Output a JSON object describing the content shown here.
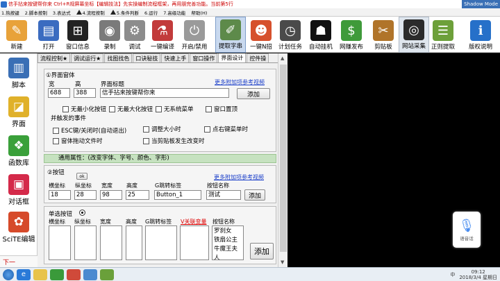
{
  "titlebar": {
    "text": "信手拈来按键帮你来 Ctrl+R规屏幕坐标【编辑技法】先实操编制流程框架，再用朋完善功能。当前第5行",
    "badge": "Shadow Mode"
  },
  "steps": [
    {
      "label": "1.热按键"
    },
    {
      "label": "2.脚本按制"
    },
    {
      "label": "3.表达式"
    },
    {
      "label": "4.流程按制"
    },
    {
      "label": "5.条件判断"
    },
    {
      "label": "6.运行"
    },
    {
      "label": "7.高级功能"
    },
    {
      "label": "帮助(H)"
    }
  ],
  "toolbar": [
    {
      "label": "新建",
      "icon": "new-doc-icon",
      "color": "#e8a23a",
      "glyph": "✎"
    },
    {
      "label": "打开",
      "icon": "open-book-icon",
      "color": "#3b6cc0",
      "glyph": "▤"
    },
    {
      "label": "窗口信息",
      "icon": "window-info-icon",
      "color": "#222222",
      "glyph": "⊞"
    },
    {
      "label": "录制",
      "icon": "webcam-icon",
      "color": "#7a7a7a",
      "glyph": "◉"
    },
    {
      "label": "调试",
      "icon": "gears-icon",
      "color": "#8c8c8c",
      "glyph": "⚙"
    },
    {
      "label": "一键编译",
      "icon": "compile-icon",
      "color": "#c23b3b",
      "glyph": "⚗"
    },
    {
      "label": "开启/禁用",
      "icon": "toggle-icon",
      "color": "#9a9a9a",
      "glyph": "⏻"
    },
    {
      "label": "提取字串",
      "icon": "pen-icon",
      "color": "#5d8a4a",
      "glyph": "✐"
    },
    {
      "label": "一键N招",
      "icon": "avatar-icon",
      "color": "#d6502c",
      "glyph": "☻"
    },
    {
      "label": "计划任务",
      "icon": "clock-icon",
      "color": "#4a4a4a",
      "glyph": "◷"
    },
    {
      "label": "自动挂机",
      "icon": "robot-icon",
      "color": "#111111",
      "glyph": "☗"
    },
    {
      "label": "网赚发布",
      "icon": "money-icon",
      "color": "#3f9a3a",
      "glyph": "$"
    },
    {
      "label": "剪贴板",
      "icon": "clipboard-icon",
      "color": "#b0742a",
      "glyph": "✂"
    },
    {
      "label": "网站采集",
      "icon": "globe-icon",
      "color": "#2b2b2b",
      "glyph": "◎"
    },
    {
      "label": "正则提取",
      "icon": "regex-icon",
      "color": "#6da03a",
      "glyph": "☰"
    },
    {
      "label": "版权说明",
      "icon": "accessibility-icon",
      "color": "#2670c9",
      "glyph": "ℹ"
    }
  ],
  "tabs": [
    {
      "label": "流程控制★"
    },
    {
      "label": "调试运行★"
    },
    {
      "label": "找图找色"
    },
    {
      "label": "口诀秘技"
    },
    {
      "label": "快速上手"
    },
    {
      "label": "窗口操作"
    },
    {
      "label": "界面设计"
    },
    {
      "label": "控件操"
    }
  ],
  "leftbar": [
    {
      "label": "脚本",
      "icon": "book-icon",
      "color": "#3a6fb5",
      "glyph": "▥"
    },
    {
      "label": "界面",
      "icon": "ruler-icon",
      "color": "#e0b12a",
      "glyph": "◪"
    },
    {
      "label": "函数库",
      "icon": "gift-icon",
      "color": "#3aa03a",
      "glyph": "❖"
    },
    {
      "label": "对话框",
      "icon": "dialog-icon",
      "color": "#d42a4a",
      "glyph": "▣"
    },
    {
      "label": "SciTE编辑",
      "icon": "popcorn-icon",
      "color": "#d64a2a",
      "glyph": "✿"
    }
  ],
  "leftbar_bottom": "下一",
  "window_section": {
    "title": "①界面窗体",
    "link": "更多附加项参考视频",
    "width_label": "宽",
    "height_label": "高",
    "caption_label": "界面标题",
    "width_value": "688",
    "height_value": "388",
    "caption_value": "信手拈来按键帮你来",
    "add_label": "添加",
    "options": [
      {
        "label": "无最小化按钮"
      },
      {
        "label": "无最大化按钮"
      },
      {
        "label": "无系统菜单"
      },
      {
        "label": "窗口置顶"
      }
    ],
    "events_title": "并触发的事件",
    "events": [
      {
        "label": "ESC键/关闭时(自动退出)"
      },
      {
        "label": "调整大小时"
      },
      {
        "label": "点右键菜单时"
      },
      {
        "label": "窗体拖动文件时"
      },
      {
        "label": "当剪贴板发生改变时"
      }
    ]
  },
  "common_props": "通用属性：(改变字体、字号、颜色、字形)",
  "button_section": {
    "title": "②按钮",
    "ok_label": "ok",
    "link": "更多附加项参考视频",
    "headers": [
      "横坐标",
      "纵坐标",
      "宽度",
      "高度",
      "G跳转标签",
      "按钮名称"
    ],
    "values": [
      "18",
      "28",
      "98",
      "25",
      "Button_1",
      "测试"
    ],
    "add_label": "添加"
  },
  "radio_section": {
    "title": "单选按钮",
    "headers": [
      "横坐标",
      "纵坐标",
      "宽度",
      "高度",
      "G跳转标签",
      "V关联变量",
      "按钮名称"
    ],
    "names": [
      "罗刹女",
      "铁扇公主",
      "牛魔王夫人"
    ],
    "add_label": "添加"
  },
  "voice": {
    "label": "语音话"
  },
  "tray": {
    "time": "09:12",
    "date": "2018/3/4 星期日",
    "ime": "中"
  },
  "taskbar_icons": [
    "start-icon",
    "ie-icon",
    "folder-icon",
    "media-icon",
    "app-icon",
    "app2-icon",
    "game-icon"
  ]
}
